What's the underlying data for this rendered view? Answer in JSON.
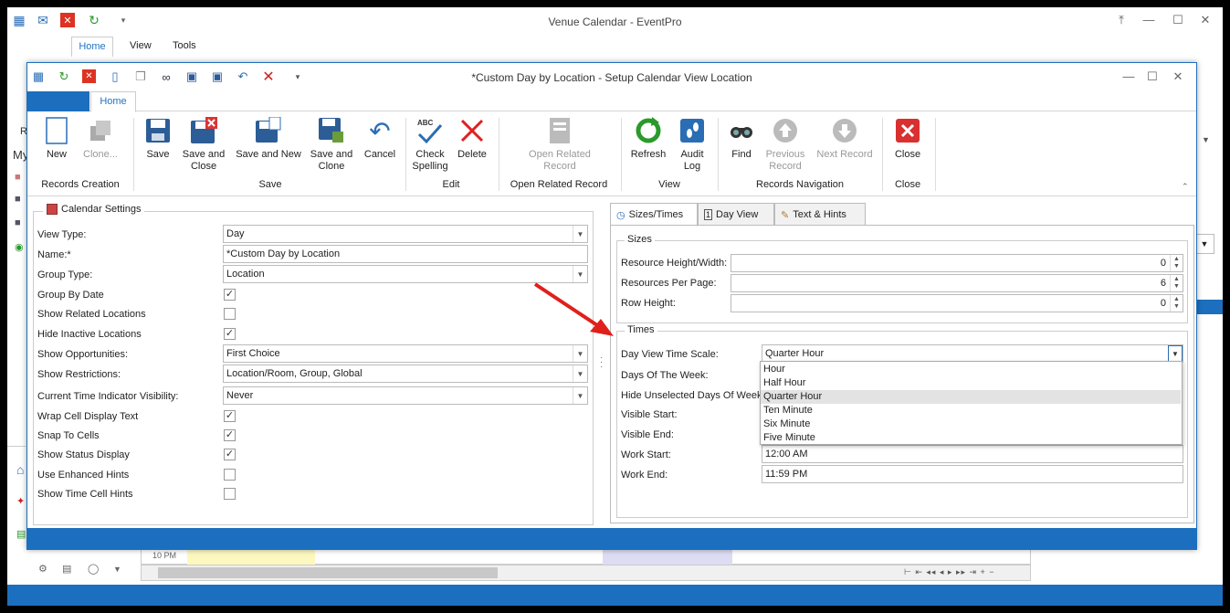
{
  "outer": {
    "title": "Venue Calendar - EventPro",
    "tabs": [
      "Home",
      "View",
      "Tools"
    ],
    "bg_left_text": [
      "R",
      "My"
    ],
    "time_label": "10 PM",
    "nav_buttons": "⊢ ⇤ ◂◂ ◂ ▸ ▸▸ ⇥ + −"
  },
  "dialog": {
    "title": "*Custom Day by Location - Setup Calendar View Location",
    "tab_home": "Home",
    "ribbon": {
      "buttons": {
        "new": "New",
        "clone": "Clone...",
        "save": "Save",
        "save_close": "Save and Close",
        "save_new": "Save and New",
        "save_clone": "Save and Clone",
        "cancel": "Cancel",
        "check_spelling": "Check Spelling",
        "delete": "Delete",
        "open_related": "Open Related Record",
        "refresh": "Refresh",
        "audit_log": "Audit Log",
        "find": "Find",
        "previous_record": "Previous Record",
        "next_record": "Next Record",
        "close": "Close"
      },
      "groups": {
        "records_creation": "Records Creation",
        "save": "Save",
        "edit": "Edit",
        "open_related_record": "Open Related Record",
        "view": "View",
        "records_navigation": "Records Navigation",
        "close": "Close"
      }
    },
    "calendar_settings": {
      "legend": "Calendar Settings",
      "view_type_label": "View Type:",
      "view_type": "Day",
      "name_label": "Name:*",
      "name": "*Custom Day by Location",
      "group_type_label": "Group Type:",
      "group_type": "Location",
      "group_by_date_label": "Group By Date",
      "group_by_date": true,
      "show_related_label": "Show Related Locations",
      "show_related": false,
      "hide_inactive_label": "Hide Inactive Locations",
      "hide_inactive": true,
      "show_opportunities_label": "Show Opportunities:",
      "show_opportunities": "First Choice",
      "show_restrictions_label": "Show Restrictions:",
      "show_restrictions": "Location/Room, Group, Global",
      "time_indicator_label": "Current Time Indicator Visibility:",
      "time_indicator": "Never",
      "wrap_text_label": "Wrap Cell Display Text",
      "wrap_text": true,
      "snap_label": "Snap To Cells",
      "snap": true,
      "status_display_label": "Show Status Display",
      "status_display": true,
      "enhanced_hints_label": "Use Enhanced Hints",
      "enhanced_hints": false,
      "time_cell_hints_label": "Show Time Cell Hints",
      "time_cell_hints": false
    },
    "right_tabs": [
      "Sizes/Times",
      "Day View",
      "Text & Hints"
    ],
    "sizes": {
      "legend": "Sizes",
      "resource_hw_label": "Resource Height/Width:",
      "resource_hw": "0",
      "resources_per_page_label": "Resources Per Page:",
      "resources_per_page": "6",
      "row_height_label": "Row Height:",
      "row_height": "0"
    },
    "times": {
      "legend": "Times",
      "time_scale_label": "Day View Time Scale:",
      "time_scale": "Quarter Hour",
      "days_of_week_label": "Days Of The Week:",
      "hide_unselected_label": "Hide Unselected Days Of Week",
      "visible_start_label": "Visible Start:",
      "visible_end_label": "Visible End:",
      "work_start_label": "Work Start:",
      "work_start": "12:00 AM",
      "work_end_label": "Work End:",
      "work_end": "11:59 PM",
      "options": [
        "Hour",
        "Half Hour",
        "Quarter Hour",
        "Ten Minute",
        "Six Minute",
        "Five Minute"
      ],
      "selected_option": "Quarter Hour"
    }
  },
  "colors": {
    "accent": "#1c6fbe",
    "annotation_arrow": "#e0201b"
  }
}
